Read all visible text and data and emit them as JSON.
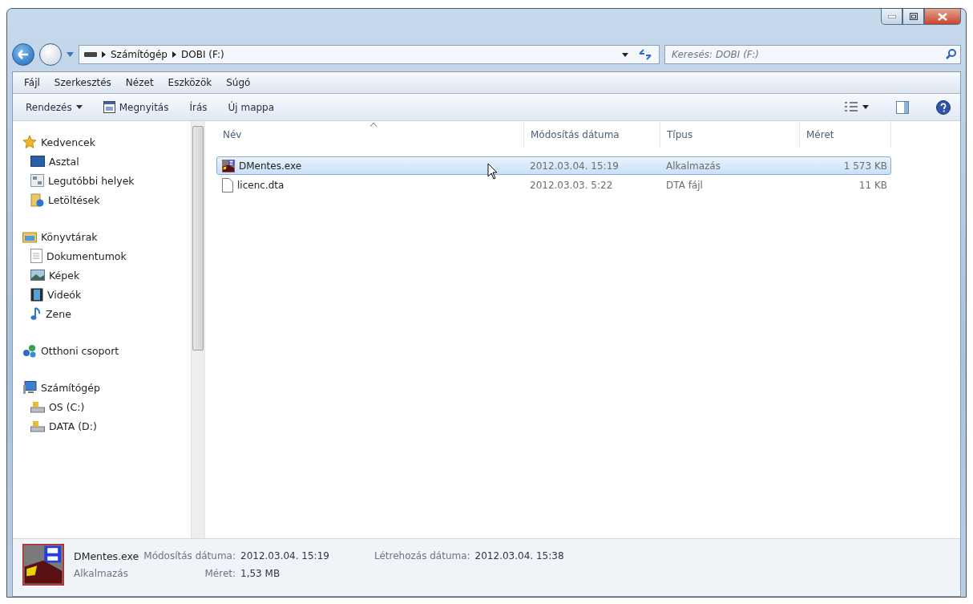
{
  "address": {
    "path": [
      "Számítógép",
      "DOBI (F:)"
    ]
  },
  "search": {
    "placeholder": "Keresés: DOBI (F:)"
  },
  "menu": [
    "Fájl",
    "Szerkesztés",
    "Nézet",
    "Eszközök",
    "Súgó"
  ],
  "toolbar": [
    {
      "label": "Rendezés",
      "kind": "dropdown"
    },
    {
      "label": "Megnyitás",
      "kind": "open"
    },
    {
      "label": "Írás",
      "kind": "plain"
    },
    {
      "label": "Új mappa",
      "kind": "plain"
    }
  ],
  "navigation": [
    {
      "label": "Kedvencek",
      "kind": "star",
      "children": [
        {
          "label": "Asztal",
          "kind": "desktop"
        },
        {
          "label": "Legutóbbi helyek",
          "kind": "recent"
        },
        {
          "label": "Letöltések",
          "kind": "downloads"
        }
      ]
    },
    {
      "label": "Könyvtárak",
      "kind": "library",
      "children": [
        {
          "label": "Dokumentumok",
          "kind": "document"
        },
        {
          "label": "Képek",
          "kind": "pictures"
        },
        {
          "label": "Videók",
          "kind": "videos"
        },
        {
          "label": "Zene",
          "kind": "music"
        }
      ]
    },
    {
      "label": "Otthoni csoport",
      "kind": "homegroup"
    },
    {
      "label": "Számítógép",
      "kind": "computer",
      "children": [
        {
          "label": "OS (C:)",
          "kind": "drive"
        },
        {
          "label": "DATA (D:)",
          "kind": "drive"
        }
      ]
    }
  ],
  "columns": [
    {
      "label": "Név",
      "sorted": true
    },
    {
      "label": "Módosítás dátuma",
      "sorted": false
    },
    {
      "label": "Típus",
      "sorted": false
    },
    {
      "label": "Méret",
      "sorted": false
    }
  ],
  "rows": [
    {
      "name": "DMentes.exe",
      "kind": "exe",
      "modified": "2012.03.04. 15:19",
      "type": "Alkalmazás",
      "size": "1 573 KB",
      "selected": true
    },
    {
      "name": "licenc.dta",
      "kind": "file",
      "modified": "2012.03.03. 5:22",
      "type": "DTA fájl",
      "size": "11 KB",
      "selected": false
    }
  ],
  "details": {
    "name": "DMentes.exe",
    "type": "Alkalmazás",
    "fields": [
      {
        "label": "Módosítás dátuma:",
        "value": "2012.03.04. 15:19"
      },
      {
        "label": "Méret:",
        "value": "1,53 MB"
      },
      {
        "label": "Létrehozás dátuma:",
        "value": "2012.03.04. 15:38"
      }
    ]
  }
}
